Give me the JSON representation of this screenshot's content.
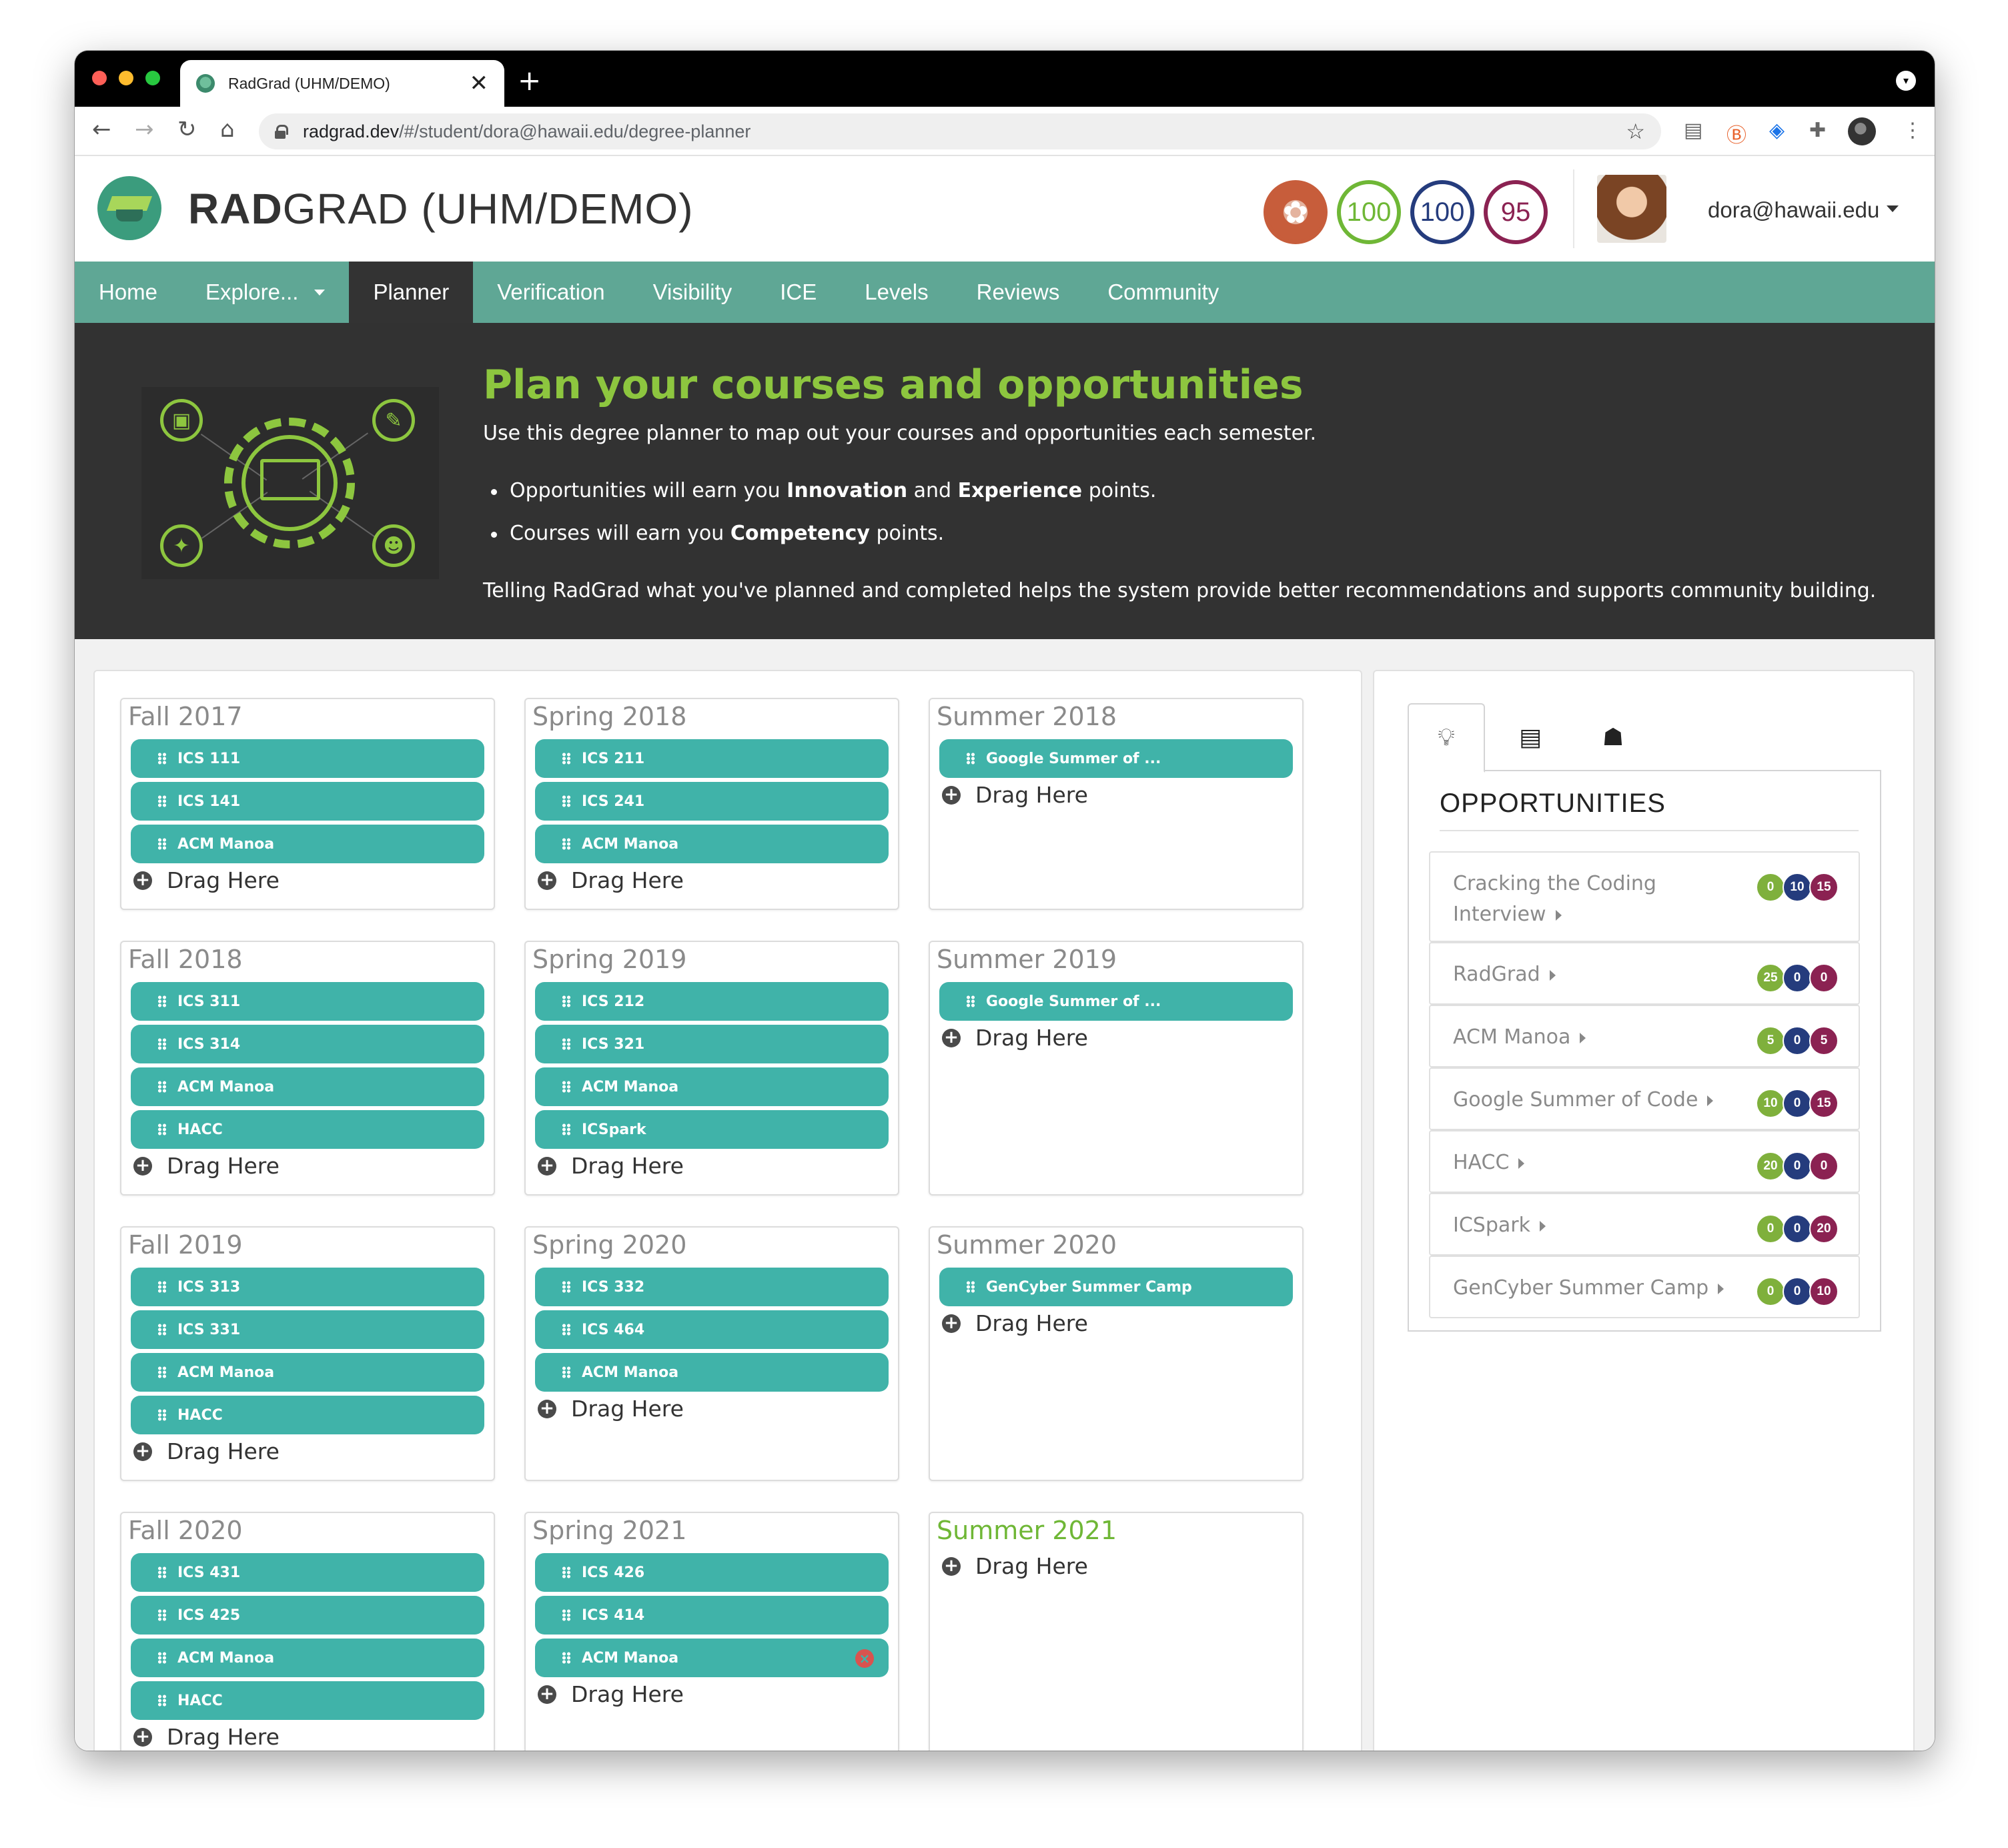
{
  "browser": {
    "tab_title": "RadGrad (UHM/DEMO)",
    "tab_close": "✕",
    "new_tab": "+",
    "url_domain": "radgrad.dev",
    "url_path": "/#/student/dora@hawaii.edu/degree-planner"
  },
  "header": {
    "brand_bold": "RAD",
    "brand_rest": "GRAD (UHM/DEMO)",
    "scores": {
      "innovation": "100",
      "competency": "100",
      "experience": "95"
    },
    "user_email": "dora@hawaii.edu"
  },
  "menu": {
    "items": [
      "Home",
      "Explore...",
      "Planner",
      "Verification",
      "Visibility",
      "ICE",
      "Levels",
      "Reviews",
      "Community"
    ],
    "active": "Planner"
  },
  "hero": {
    "title": "Plan your courses and opportunities",
    "intro": "Use this degree planner to map out your courses and opportunities each semester.",
    "bullet1_pre": "Opportunities will earn you ",
    "bullet1_b1": "Innovation",
    "bullet1_mid": " and ",
    "bullet1_b2": "Experience",
    "bullet1_post": " points.",
    "bullet2_pre": "Courses will earn you ",
    "bullet2_b": "Competency",
    "bullet2_post": " points.",
    "outro": "Telling RadGrad what you've planned and completed helps the system provide better recommendations and supports community building."
  },
  "planner": {
    "drag_label": "Drag Here",
    "semesters": [
      {
        "name": "Fall 2017",
        "items": [
          "ICS 111",
          "ICS 141",
          "ACM Manoa"
        ]
      },
      {
        "name": "Spring 2018",
        "items": [
          "ICS 211",
          "ICS 241",
          "ACM Manoa"
        ]
      },
      {
        "name": "Summer 2018",
        "items": [
          "Google Summer of ..."
        ]
      },
      {
        "name": "Fall 2018",
        "items": [
          "ICS 311",
          "ICS 314",
          "ACM Manoa",
          "HACC"
        ]
      },
      {
        "name": "Spring 2019",
        "items": [
          "ICS 212",
          "ICS 321",
          "ACM Manoa",
          "ICSpark"
        ]
      },
      {
        "name": "Summer 2019",
        "items": [
          "Google Summer of ..."
        ]
      },
      {
        "name": "Fall 2019",
        "items": [
          "ICS 313",
          "ICS 331",
          "ACM Manoa",
          "HACC"
        ]
      },
      {
        "name": "Spring 2020",
        "items": [
          "ICS 332",
          "ICS 464",
          "ACM Manoa"
        ]
      },
      {
        "name": "Summer 2020",
        "items": [
          "GenCyber Summer Camp"
        ]
      },
      {
        "name": "Fall 2020",
        "items": [
          "ICS 431",
          "ICS 425",
          "ACM Manoa",
          "HACC"
        ]
      },
      {
        "name": "Spring 2021",
        "items": [
          "ICS 426",
          "ICS 414",
          "ACM Manoa"
        ]
      },
      {
        "name": "Summer 2021",
        "items": [],
        "current": true
      }
    ]
  },
  "sidebar": {
    "heading": "OPPORTUNITIES",
    "tabs": [
      "lightbulb-icon",
      "book-icon",
      "user-graduate-icon"
    ],
    "opportunities": [
      {
        "name": "Cracking the Coding Interview",
        "i": "0",
        "c": "10",
        "e": "15"
      },
      {
        "name": "RadGrad",
        "i": "25",
        "c": "0",
        "e": "0"
      },
      {
        "name": "ACM Manoa",
        "i": "5",
        "c": "0",
        "e": "5"
      },
      {
        "name": "Google Summer of Code",
        "i": "10",
        "c": "0",
        "e": "15"
      },
      {
        "name": "HACC",
        "i": "20",
        "c": "0",
        "e": "0"
      },
      {
        "name": "ICSpark",
        "i": "0",
        "c": "0",
        "e": "20"
      },
      {
        "name": "GenCyber Summer Camp",
        "i": "0",
        "c": "0",
        "e": "10"
      }
    ]
  },
  "colors": {
    "accent": "#5fa795",
    "pill": "#40b3a9",
    "hero_bg": "#323232",
    "hero_title": "#8dc63f"
  }
}
